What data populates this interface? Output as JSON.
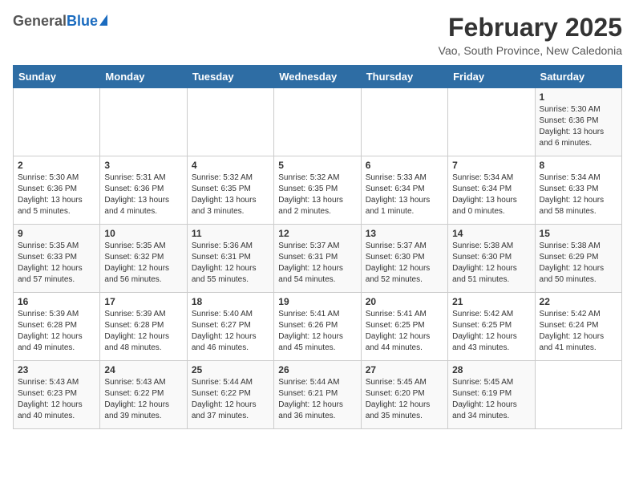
{
  "header": {
    "logo_general": "General",
    "logo_blue": "Blue",
    "month_year": "February 2025",
    "location": "Vao, South Province, New Caledonia"
  },
  "weekdays": [
    "Sunday",
    "Monday",
    "Tuesday",
    "Wednesday",
    "Thursday",
    "Friday",
    "Saturday"
  ],
  "weeks": [
    [
      {
        "day": "",
        "info": ""
      },
      {
        "day": "",
        "info": ""
      },
      {
        "day": "",
        "info": ""
      },
      {
        "day": "",
        "info": ""
      },
      {
        "day": "",
        "info": ""
      },
      {
        "day": "",
        "info": ""
      },
      {
        "day": "1",
        "info": "Sunrise: 5:30 AM\nSunset: 6:36 PM\nDaylight: 13 hours\nand 6 minutes."
      }
    ],
    [
      {
        "day": "2",
        "info": "Sunrise: 5:30 AM\nSunset: 6:36 PM\nDaylight: 13 hours\nand 5 minutes."
      },
      {
        "day": "3",
        "info": "Sunrise: 5:31 AM\nSunset: 6:36 PM\nDaylight: 13 hours\nand 4 minutes."
      },
      {
        "day": "4",
        "info": "Sunrise: 5:32 AM\nSunset: 6:35 PM\nDaylight: 13 hours\nand 3 minutes."
      },
      {
        "day": "5",
        "info": "Sunrise: 5:32 AM\nSunset: 6:35 PM\nDaylight: 13 hours\nand 2 minutes."
      },
      {
        "day": "6",
        "info": "Sunrise: 5:33 AM\nSunset: 6:34 PM\nDaylight: 13 hours\nand 1 minute."
      },
      {
        "day": "7",
        "info": "Sunrise: 5:34 AM\nSunset: 6:34 PM\nDaylight: 13 hours\nand 0 minutes."
      },
      {
        "day": "8",
        "info": "Sunrise: 5:34 AM\nSunset: 6:33 PM\nDaylight: 12 hours\nand 58 minutes."
      }
    ],
    [
      {
        "day": "9",
        "info": "Sunrise: 5:35 AM\nSunset: 6:33 PM\nDaylight: 12 hours\nand 57 minutes."
      },
      {
        "day": "10",
        "info": "Sunrise: 5:35 AM\nSunset: 6:32 PM\nDaylight: 12 hours\nand 56 minutes."
      },
      {
        "day": "11",
        "info": "Sunrise: 5:36 AM\nSunset: 6:31 PM\nDaylight: 12 hours\nand 55 minutes."
      },
      {
        "day": "12",
        "info": "Sunrise: 5:37 AM\nSunset: 6:31 PM\nDaylight: 12 hours\nand 54 minutes."
      },
      {
        "day": "13",
        "info": "Sunrise: 5:37 AM\nSunset: 6:30 PM\nDaylight: 12 hours\nand 52 minutes."
      },
      {
        "day": "14",
        "info": "Sunrise: 5:38 AM\nSunset: 6:30 PM\nDaylight: 12 hours\nand 51 minutes."
      },
      {
        "day": "15",
        "info": "Sunrise: 5:38 AM\nSunset: 6:29 PM\nDaylight: 12 hours\nand 50 minutes."
      }
    ],
    [
      {
        "day": "16",
        "info": "Sunrise: 5:39 AM\nSunset: 6:28 PM\nDaylight: 12 hours\nand 49 minutes."
      },
      {
        "day": "17",
        "info": "Sunrise: 5:39 AM\nSunset: 6:28 PM\nDaylight: 12 hours\nand 48 minutes."
      },
      {
        "day": "18",
        "info": "Sunrise: 5:40 AM\nSunset: 6:27 PM\nDaylight: 12 hours\nand 46 minutes."
      },
      {
        "day": "19",
        "info": "Sunrise: 5:41 AM\nSunset: 6:26 PM\nDaylight: 12 hours\nand 45 minutes."
      },
      {
        "day": "20",
        "info": "Sunrise: 5:41 AM\nSunset: 6:25 PM\nDaylight: 12 hours\nand 44 minutes."
      },
      {
        "day": "21",
        "info": "Sunrise: 5:42 AM\nSunset: 6:25 PM\nDaylight: 12 hours\nand 43 minutes."
      },
      {
        "day": "22",
        "info": "Sunrise: 5:42 AM\nSunset: 6:24 PM\nDaylight: 12 hours\nand 41 minutes."
      }
    ],
    [
      {
        "day": "23",
        "info": "Sunrise: 5:43 AM\nSunset: 6:23 PM\nDaylight: 12 hours\nand 40 minutes."
      },
      {
        "day": "24",
        "info": "Sunrise: 5:43 AM\nSunset: 6:22 PM\nDaylight: 12 hours\nand 39 minutes."
      },
      {
        "day": "25",
        "info": "Sunrise: 5:44 AM\nSunset: 6:22 PM\nDaylight: 12 hours\nand 37 minutes."
      },
      {
        "day": "26",
        "info": "Sunrise: 5:44 AM\nSunset: 6:21 PM\nDaylight: 12 hours\nand 36 minutes."
      },
      {
        "day": "27",
        "info": "Sunrise: 5:45 AM\nSunset: 6:20 PM\nDaylight: 12 hours\nand 35 minutes."
      },
      {
        "day": "28",
        "info": "Sunrise: 5:45 AM\nSunset: 6:19 PM\nDaylight: 12 hours\nand 34 minutes."
      },
      {
        "day": "",
        "info": ""
      }
    ]
  ]
}
